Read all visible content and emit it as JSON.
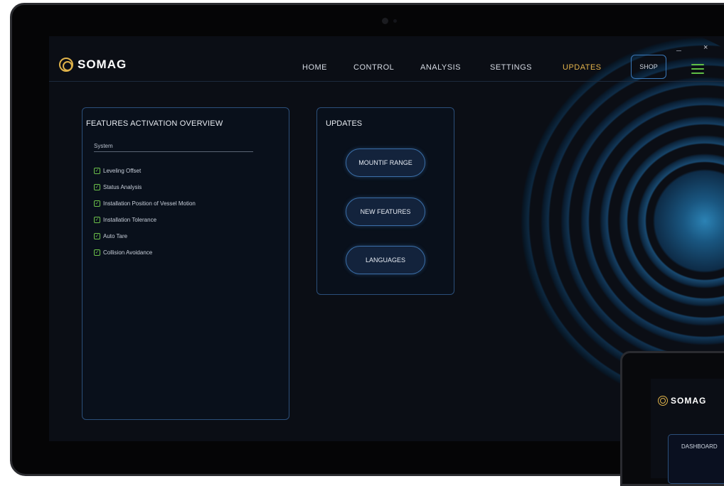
{
  "app": {
    "brand": "SOMAG",
    "logo_icon": "somag-logo-icon"
  },
  "nav": {
    "items": [
      {
        "label": "HOME",
        "active": false
      },
      {
        "label": "CONTROL",
        "active": false
      },
      {
        "label": "ANALYSIS",
        "active": false
      },
      {
        "label": "SETTINGS",
        "active": false
      },
      {
        "label": "UPDATES",
        "active": true
      }
    ],
    "box_label": "SHOP",
    "close_symbol": "×",
    "menu_icon": "hamburger-menu-icon",
    "accent_color": "#e3b24b",
    "menu_color": "#5fbf45"
  },
  "features_panel": {
    "title": "FEATURES ACTIVATION OVERVIEW",
    "subtitle": "System",
    "items": [
      {
        "label": "Leveling Offset",
        "checked": true
      },
      {
        "label": "Status Analysis",
        "checked": true
      },
      {
        "label": "Installation Position of Vessel Motion",
        "checked": true
      },
      {
        "label": "Installation Tolerance",
        "checked": true
      },
      {
        "label": "Auto Tare",
        "checked": true
      },
      {
        "label": "Collision Avoidance",
        "checked": true
      }
    ],
    "check_color": "#6cc04a"
  },
  "updates_panel": {
    "title": "UPDATES",
    "buttons": [
      {
        "label": "MOUNTIF RANGE"
      },
      {
        "label": "NEW FEATURES"
      },
      {
        "label": "LANGUAGES"
      }
    ]
  },
  "secondary_device": {
    "brand": "SOMAG",
    "tab_label": "DASHBOARD"
  }
}
